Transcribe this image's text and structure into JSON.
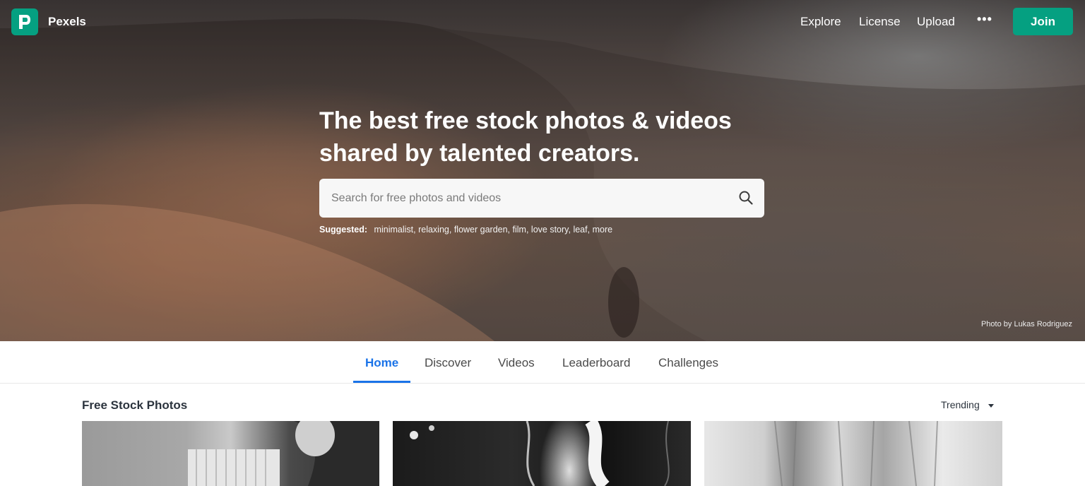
{
  "brand": {
    "name": "Pexels",
    "accent_color": "#05a081"
  },
  "nav": {
    "links": [
      "Explore",
      "License",
      "Upload"
    ],
    "more_icon": "more-dots-icon",
    "join_label": "Join"
  },
  "hero": {
    "headline": "The best free stock photos & videos shared by talented creators.",
    "search_placeholder": "Search for free photos and videos",
    "suggested_label": "Suggested:",
    "suggested_tags": [
      "minimalist,",
      "relaxing,",
      "flower garden,",
      "film,",
      "love story,",
      "leaf,",
      "more"
    ],
    "photo_credit": "Photo by Lukas Rodriguez"
  },
  "tabs": {
    "items": [
      "Home",
      "Discover",
      "Videos",
      "Leaderboard",
      "Challenges"
    ],
    "active": "Home",
    "active_color": "#1a73e8"
  },
  "content": {
    "section_title": "Free Stock Photos",
    "sort_label": "Trending"
  }
}
